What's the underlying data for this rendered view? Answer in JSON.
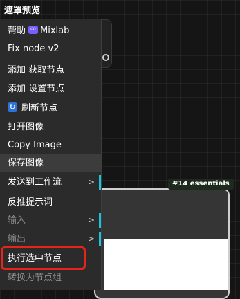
{
  "menu": {
    "title": "遮罩预览",
    "items": [
      {
        "label": "帮助",
        "suffix": "Mixlab",
        "icon": "mixlab-icon"
      },
      {
        "label": "Fix node v2"
      },
      {
        "label": "添加 获取节点"
      },
      {
        "label": "添加 设置节点"
      },
      {
        "label": "刷新节点",
        "icon": "refresh-icon"
      },
      {
        "label": "打开图像"
      },
      {
        "label": "Copy Image"
      },
      {
        "label": "保存图像",
        "state": "hovered"
      },
      {
        "label": "发送到工作流",
        "submenu": true
      },
      {
        "label": "反推提示词"
      },
      {
        "label": "输入",
        "submenu": true,
        "disabled": true
      },
      {
        "label": "输出",
        "submenu": true,
        "disabled": true
      },
      {
        "label": "执行选中节点",
        "annotated": true
      },
      {
        "label": "转换为节点组",
        "disabled": true
      }
    ],
    "submenu_glyph": ">"
  },
  "node": {
    "badge": "#14 essentials"
  },
  "colors": {
    "annotation": "#e8231a",
    "accent": "#19c6e0",
    "mixlab": "#7a5cff",
    "refresh": "#2d73d9"
  }
}
